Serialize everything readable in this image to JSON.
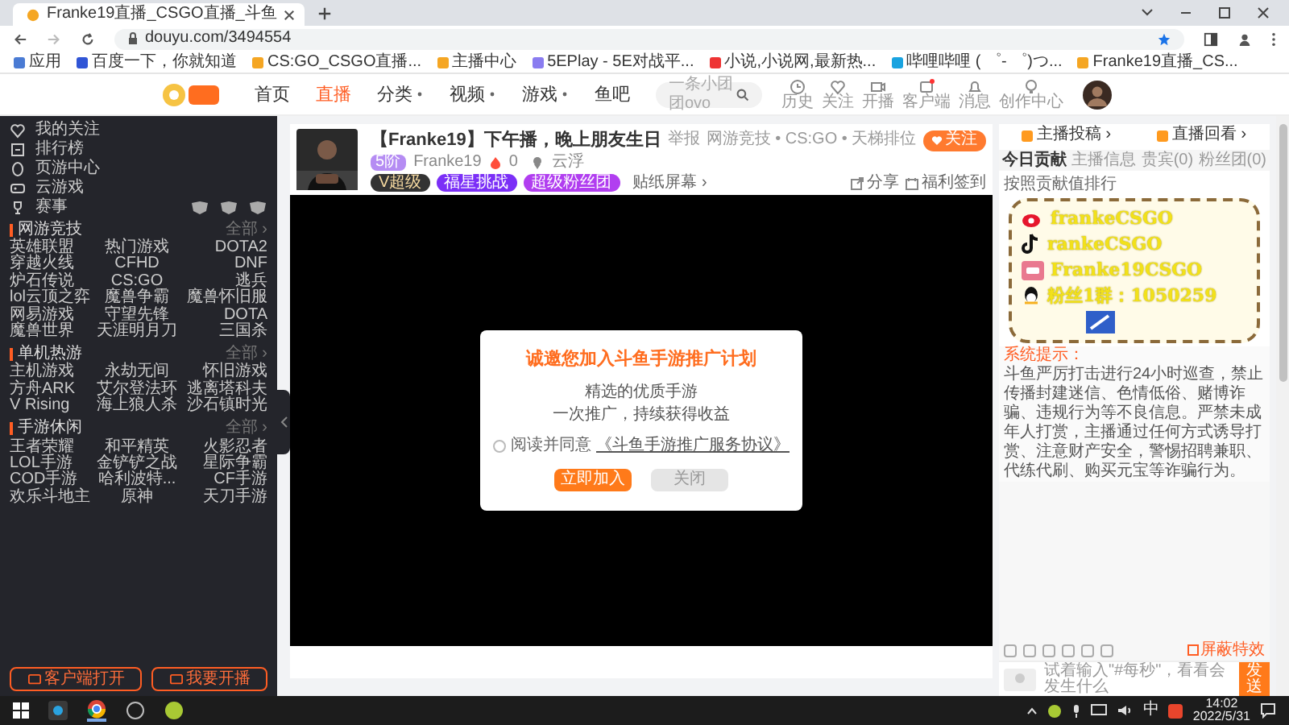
{
  "browser": {
    "tab_title": "Franke19直播_CSGO直播_斗鱼",
    "url": "douyu.com/3494554",
    "bookmarks": [
      "应用",
      "百度一下，你就知道",
      "CS:GO_CSGO直播...",
      "主播中心",
      "5EPlay - 5E对战平...",
      "小说,小说网,最新热...",
      "哔哩哔哩 ( ゜- ゜)つ...",
      "Franke19直播_CS..."
    ]
  },
  "site_header": {
    "nav": [
      {
        "label": "首页",
        "selected": false,
        "dropdown": false
      },
      {
        "label": "直播",
        "selected": true,
        "dropdown": false
      },
      {
        "label": "分类",
        "selected": false,
        "dropdown": true
      },
      {
        "label": "视频",
        "selected": false,
        "dropdown": true
      },
      {
        "label": "游戏",
        "selected": false,
        "dropdown": true
      },
      {
        "label": "鱼吧",
        "selected": false,
        "dropdown": false
      }
    ],
    "search_placeholder": "一条小团团ovo",
    "tools": [
      "历史",
      "关注",
      "开播",
      "客户端",
      "消息",
      "创作中心"
    ]
  },
  "sidebar": {
    "top_items": [
      "我的关注",
      "排行榜",
      "页游中心",
      "云游戏",
      "赛事"
    ],
    "sections": [
      {
        "title": "网游竞技",
        "more": "全部 ›",
        "games": [
          "英雄联盟",
          "热门游戏",
          "DOTA2",
          "穿越火线",
          "CFHD",
          "DNF",
          "炉石传说",
          "CS:GO",
          "逃兵",
          "lol云顶之弈",
          "魔兽争霸",
          "魔兽怀旧服",
          "网易游戏",
          "守望先锋",
          "DOTA",
          "魔兽世界",
          "天涯明月刀",
          "三国杀"
        ]
      },
      {
        "title": "单机热游",
        "more": "全部 ›",
        "games": [
          "主机游戏",
          "永劫无间",
          "怀旧游戏",
          "方舟ARK",
          "艾尔登法环",
          "逃离塔科夫",
          "V Rising",
          "海上狼人杀",
          "沙石镇时光"
        ]
      },
      {
        "title": "手游休闲",
        "more": "全部 ›",
        "games": [
          "王者荣耀",
          "和平精英",
          "火影忍者",
          "LOL手游",
          "金铲铲之战",
          "星际争霸",
          "COD手游",
          "哈利波特...",
          "CF手游",
          "欢乐斗地主",
          "原神",
          "天刀手游"
        ]
      }
    ],
    "buttons": [
      "客户端打开",
      "我要开播"
    ]
  },
  "room": {
    "title": "【Franke19】下午播，晚上朋友生日",
    "report": "举报",
    "category": "网游竞技 • CS:GO • 天梯排位",
    "level": "5阶",
    "streamer": "Franke19",
    "heat": "0",
    "location": "云浮",
    "chips": [
      "V超级",
      "福星挑战",
      "超级粉丝团"
    ],
    "sticker": "贴纸屏幕 ›",
    "follow": "关注",
    "share": "分享",
    "sign_in": "福利签到"
  },
  "modal": {
    "title": "诚邀您加入斗鱼手游推广计划",
    "lines": [
      "精选的优质手游",
      "一次推广，持续获得收益"
    ],
    "agree": "阅读并同意",
    "agree_link": "《斗鱼手游推广服务协议》",
    "checked": false,
    "buttons": [
      "立即加入",
      "关闭"
    ]
  },
  "right_panel": {
    "tabs": [
      "主播投稿 ›",
      "直播回看 ›"
    ],
    "subtabs": [
      {
        "label": "今日贡献",
        "selected": true
      },
      {
        "label": "主播信息",
        "selected": false
      },
      {
        "label": "贵宾(0)",
        "selected": false
      },
      {
        "label": "粉丝团(0)",
        "selected": false
      }
    ],
    "rank_note": "按照贡献值排行",
    "system_label": "系统提示：",
    "system_text": "斗鱼严厉打击进行24小时巡查，禁止传播封建迷信、色情低俗、赌博诈骗、违规行为等不良信息。严禁未成年人打赏，主播通过任何方式诱导打赏、注意财产安全，警惕招聘兼职、代练代刷、购买元宝等诈骗行为。",
    "overlay": [
      {
        "kind": "weibo",
        "text": "frankeCSGO"
      },
      {
        "kind": "douyin",
        "text": "rankeCSGO"
      },
      {
        "kind": "bilibili",
        "text": "Franke19CSGO"
      },
      {
        "kind": "qq",
        "text": "粉丝1群：1050259"
      }
    ],
    "input_placeholder": "试着输入\"#每秒\"，看看会发生什么",
    "send": "发送",
    "shield": "屏蔽特效"
  },
  "taskbar": {
    "ime": "中",
    "time": "14:02",
    "date": "2022/5/31"
  }
}
